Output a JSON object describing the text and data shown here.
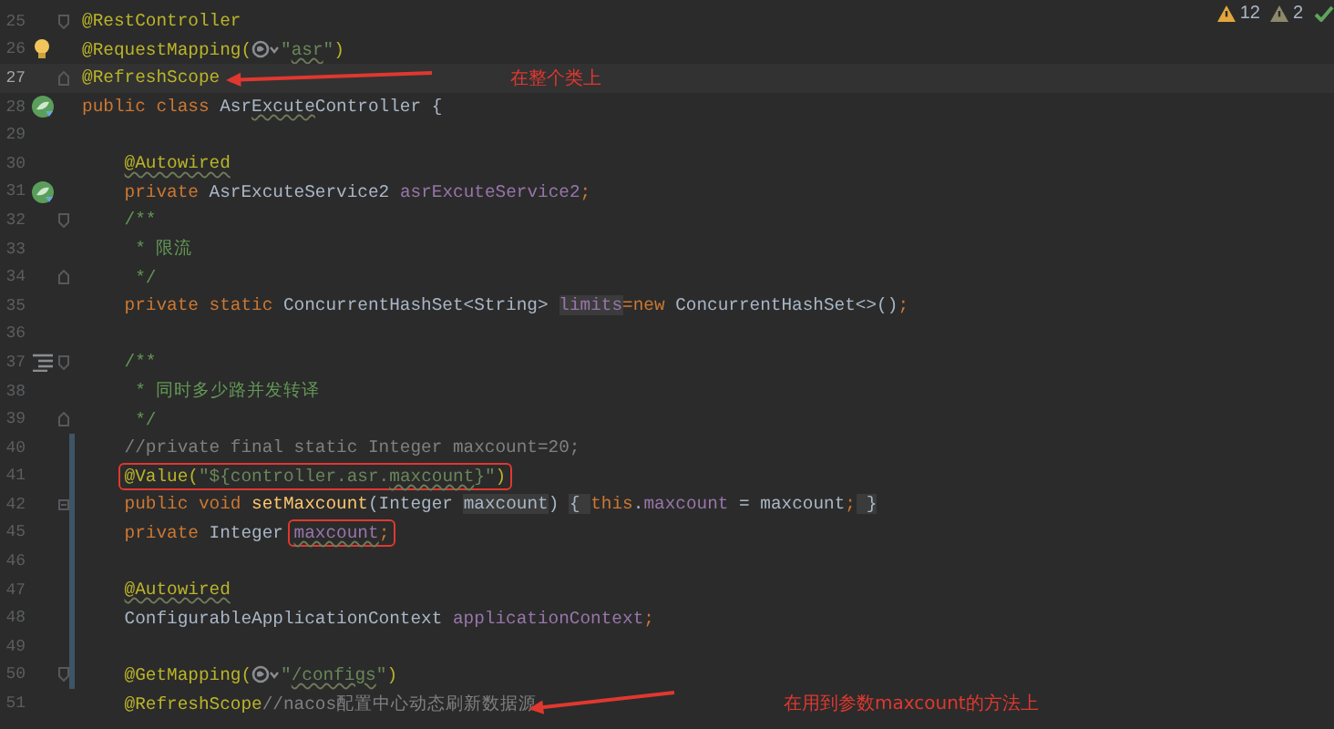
{
  "inspection_widget": [
    {
      "kind": "warning",
      "count": "12"
    },
    {
      "kind": "weak_warning",
      "count": "2"
    },
    {
      "kind": "ok"
    }
  ],
  "lines": [
    {
      "number": "25",
      "fold_start": true,
      "tokens": [
        {
          "text": "@RestController",
          "kind": "ann"
        }
      ]
    },
    {
      "number": "26",
      "bulb": true,
      "tokens": [
        {
          "text": "@RequestMapping(",
          "kind": "ann"
        },
        {
          "kind": "inlay"
        },
        {
          "text": "\"",
          "kind": "str"
        },
        {
          "text": "asr",
          "kind": "str",
          "underline": true
        },
        {
          "text": "\"",
          "kind": "str"
        },
        {
          "text": ")",
          "kind": "ann"
        }
      ]
    },
    {
      "number": "27",
      "current": true,
      "fold_end": true,
      "callout": {
        "text": "在整个类上"
      },
      "tokens": [
        {
          "text": "@RefreshScope",
          "kind": "ann"
        }
      ]
    },
    {
      "number": "28",
      "bean": true,
      "tokens": [
        {
          "text": "public class ",
          "kind": "kw"
        },
        {
          "text": "Asr",
          "kind": "plain"
        },
        {
          "text": "Excute",
          "kind": "plain",
          "underline": true
        },
        {
          "text": "Controller {",
          "kind": "plain"
        }
      ]
    },
    {
      "number": "29"
    },
    {
      "number": "30",
      "tokens": [
        {
          "text": "    @Autowired",
          "kind": "ann",
          "underline": true
        }
      ]
    },
    {
      "number": "31",
      "bean": true,
      "tokens": [
        {
          "text": "    private ",
          "kind": "kw"
        },
        {
          "text": "AsrExcuteService2 ",
          "kind": "plain"
        },
        {
          "text": "asrExcuteService2",
          "kind": "field"
        },
        {
          "text": ";",
          "kind": "kw"
        }
      ]
    },
    {
      "number": "32",
      "fold_start": true,
      "tokens": [
        {
          "text": "    /**",
          "kind": "doc"
        }
      ]
    },
    {
      "number": "33",
      "tokens": [
        {
          "text": "     * 限流",
          "kind": "doc"
        }
      ]
    },
    {
      "number": "34",
      "fold_end": true,
      "tokens": [
        {
          "text": "     */",
          "kind": "doc"
        }
      ]
    },
    {
      "number": "35",
      "tokens": [
        {
          "text": "    private static ",
          "kind": "kw"
        },
        {
          "text": "ConcurrentHashSet<String> ",
          "kind": "plain"
        },
        {
          "text": "limits",
          "kind": "field",
          "unused": true
        },
        {
          "text": "=new ",
          "kind": "kw"
        },
        {
          "text": "ConcurrentHashSet<>()",
          "kind": "plain"
        },
        {
          "text": ";",
          "kind": "kw"
        }
      ]
    },
    {
      "number": "36"
    },
    {
      "number": "37",
      "list_icon": true,
      "fold_start": true,
      "tokens": [
        {
          "text": "    /**",
          "kind": "doc"
        }
      ]
    },
    {
      "number": "38",
      "tokens": [
        {
          "text": "     * 同时多少路并发转译",
          "kind": "doc"
        }
      ]
    },
    {
      "number": "39",
      "fold_end": true,
      "tokens": [
        {
          "text": "     */",
          "kind": "doc"
        }
      ]
    },
    {
      "number": "40",
      "changed": true,
      "tokens": [
        {
          "text": "    //private final static Integer maxcount=20;",
          "kind": "comment"
        }
      ]
    },
    {
      "number": "41",
      "changed": true,
      "tokens": [
        {
          "text": "    @Value(",
          "kind": "ann",
          "boxed": true
        },
        {
          "text": "\"${controller.asr.",
          "kind": "str",
          "boxed": true
        },
        {
          "text": "maxcount",
          "kind": "str",
          "boxed": true,
          "underline": true
        },
        {
          "text": "}\"",
          "kind": "str",
          "boxed": true
        },
        {
          "text": ")",
          "kind": "ann",
          "boxed": true
        }
      ]
    },
    {
      "number": "42",
      "changed": true,
      "folded": true,
      "tokens": [
        {
          "text": "    public void ",
          "kind": "kw"
        },
        {
          "text": "setMaxcount",
          "kind": "method"
        },
        {
          "text": "(Integer ",
          "kind": "plain"
        },
        {
          "text": "maxcount",
          "kind": "plain",
          "unused": true
        },
        {
          "text": ") ",
          "kind": "plain"
        },
        {
          "text": "{ ",
          "kind": "plain",
          "unused": true
        },
        {
          "text": "this",
          "kind": "kw"
        },
        {
          "text": ".",
          "kind": "plain"
        },
        {
          "text": "maxcount",
          "kind": "field"
        },
        {
          "text": " = maxcount",
          "kind": "plain"
        },
        {
          "text": ";",
          "kind": "kw"
        },
        {
          "text": " }",
          "kind": "plain",
          "unused": true
        }
      ]
    },
    {
      "number": "45",
      "changed": true,
      "tokens": [
        {
          "text": "    private ",
          "kind": "kw"
        },
        {
          "text": "Integer ",
          "kind": "plain"
        },
        {
          "text": "maxcount",
          "kind": "field",
          "boxed": true,
          "underline": true
        },
        {
          "text": ";",
          "kind": "kw",
          "boxed": true
        }
      ]
    },
    {
      "number": "46",
      "changed": true
    },
    {
      "number": "47",
      "changed": true,
      "tokens": [
        {
          "text": "    @Autowired",
          "kind": "ann",
          "underline": true
        }
      ]
    },
    {
      "number": "48",
      "changed": true,
      "tokens": [
        {
          "text": "    ConfigurableApplicationContext ",
          "kind": "plain"
        },
        {
          "text": "applicationContext",
          "kind": "field"
        },
        {
          "text": ";",
          "kind": "kw"
        }
      ]
    },
    {
      "number": "49",
      "changed": true
    },
    {
      "number": "50",
      "changed": true,
      "fold_start": true,
      "tokens": [
        {
          "text": "    @GetMapping(",
          "kind": "ann"
        },
        {
          "kind": "inlay"
        },
        {
          "text": "\"",
          "kind": "str"
        },
        {
          "text": "/configs",
          "kind": "str",
          "underline": true
        },
        {
          "text": "\"",
          "kind": "str"
        },
        {
          "text": ")",
          "kind": "ann"
        }
      ]
    },
    {
      "number": "51",
      "callout": {
        "text": "在用到参数maxcount的方法上"
      },
      "tokens": [
        {
          "text": "    @RefreshScope",
          "kind": "ann"
        },
        {
          "text": "//nacos配置中心动态刷新数据源",
          "kind": "comment"
        }
      ]
    }
  ]
}
